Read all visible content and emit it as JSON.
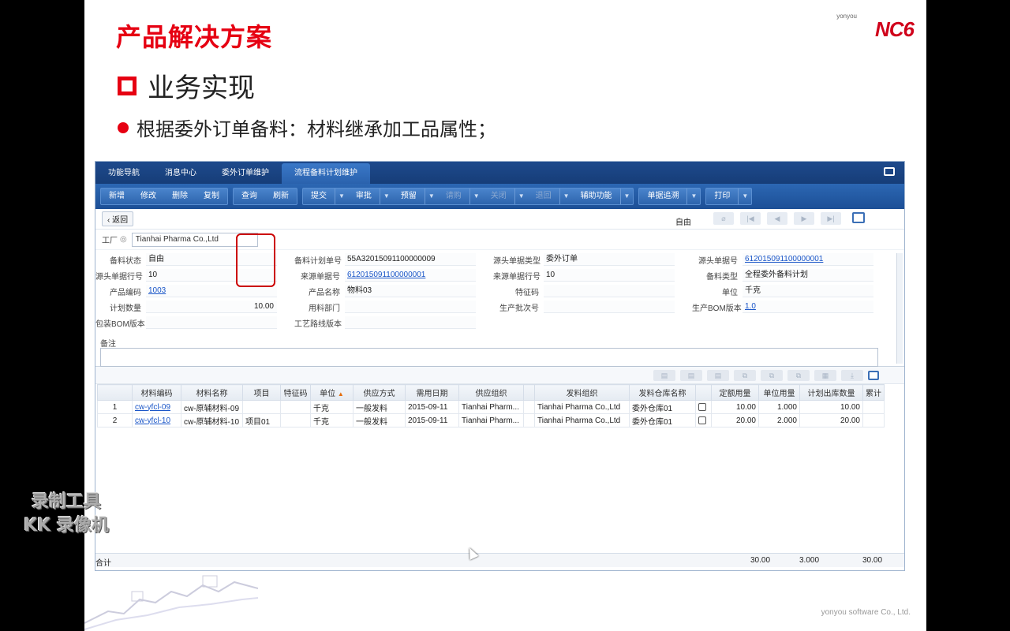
{
  "slide": {
    "title": "产品解决方案",
    "logo_small": "yonyou",
    "logo_main": "NC6",
    "heading": "业务实现",
    "bullet": "根据委外订单备料：材料继承加工品属性；",
    "footer": "yonyou software Co., Ltd.",
    "watermark_line1": "录制工具",
    "watermark_line2": "KK 录像机"
  },
  "app": {
    "tabs": [
      "功能导航",
      "消息中心",
      "委外订单维护",
      "流程备料计划维护"
    ],
    "active_tab_index": 3,
    "toolbar": {
      "new": "新增",
      "edit": "修改",
      "delete": "删除",
      "copy": "复制",
      "query": "查询",
      "refresh": "刷新",
      "submit": "提交",
      "approve": "审批",
      "reserve": "预留",
      "rerequest": "请购",
      "close": "关闭",
      "return": "退回",
      "aux": "辅助功能",
      "trace": "单据追溯",
      "print": "打印"
    },
    "nav": {
      "back": "返回",
      "status": "自由"
    },
    "factory": {
      "label": "工厂",
      "value": "Tianhai Pharma Co.,Ltd"
    },
    "form": {
      "fields": [
        {
          "label": "备料状态",
          "value": "自由"
        },
        {
          "label": "备料计划单号",
          "value": "55A32015091100000009"
        },
        {
          "label": "源头单据类型",
          "value": "委外订单"
        },
        {
          "label": "源头单据号",
          "value": "612015091100000001",
          "link": true
        },
        {
          "label": "源头单据行号",
          "value": "10"
        },
        {
          "label": "来源单据号",
          "value": "612015091100000001",
          "link": true
        },
        {
          "label": "来源单据行号",
          "value": "10"
        },
        {
          "label": "备料类型",
          "value": "全程委外备料计划"
        },
        {
          "label": "产品编码",
          "value": "1003",
          "link": true
        },
        {
          "label": "产品名称",
          "value": "物料03"
        },
        {
          "label": "特征码",
          "value": ""
        },
        {
          "label": "单位",
          "value": "千克"
        },
        {
          "label": "计划数量",
          "value": "10.00",
          "num": true
        },
        {
          "label": "用料部门",
          "value": ""
        },
        {
          "label": "生产批次号",
          "value": ""
        },
        {
          "label": "生产BOM版本",
          "value": "1.0",
          "link": true
        },
        {
          "label": "包装BOM版本",
          "value": ""
        },
        {
          "label": "工艺路线版本",
          "value": ""
        }
      ],
      "remark_label": "备注"
    },
    "grid": {
      "columns": [
        "",
        "材料编码",
        "材料名称",
        "项目",
        "特征码",
        "单位",
        "供应方式",
        "需用日期",
        "供应组织",
        "",
        "发料组织",
        "发料仓库名称",
        "",
        "定额用量",
        "单位用量",
        "计划出库数量",
        "累计"
      ],
      "rows": [
        {
          "no": "1",
          "code": "cw-yfcl-09",
          "name": "cw-原辅材料-09",
          "project": "",
          "feature": "",
          "unit": "千克",
          "supply": "一般发料",
          "date": "2015-09-11",
          "supply_org": "Tianhai Pharm...",
          "issue_org": "Tianhai Pharma Co.,Ltd",
          "warehouse": "委外仓库01",
          "quota": "10.00",
          "unit_qty": "1.000",
          "plan_out": "10.00"
        },
        {
          "no": "2",
          "code": "cw-yfcl-10",
          "name": "cw-原辅材料-10",
          "project": "项目01",
          "feature": "",
          "unit": "千克",
          "supply": "一般发料",
          "date": "2015-09-11",
          "supply_org": "Tianhai Pharm...",
          "issue_org": "Tianhai Pharma Co.,Ltd",
          "warehouse": "委外仓库01",
          "quota": "20.00",
          "unit_qty": "2.000",
          "plan_out": "20.00"
        }
      ],
      "totals": {
        "label": "合计",
        "quota": "30.00",
        "unit_qty": "3.000",
        "plan_out": "30.00"
      }
    }
  }
}
